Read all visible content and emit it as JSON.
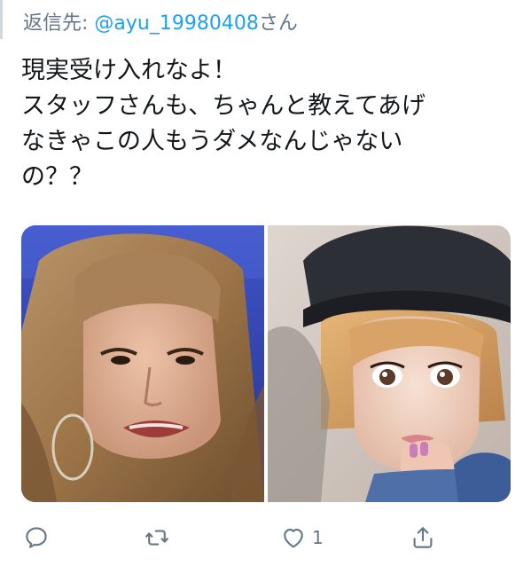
{
  "reply": {
    "prefix": "返信先: ",
    "mention": "@ayu_19980408",
    "suffix": "さん"
  },
  "tweet": {
    "lines": [
      "現実受け入れなよ！",
      "スタッフさんも、ちゃんと教えてあげ",
      "なきゃこの人もうダメなんじゃない",
      "の？？"
    ]
  },
  "media": {
    "photos": [
      {
        "subject": "photo-left"
      },
      {
        "subject": "photo-right"
      }
    ]
  },
  "actions": {
    "reply_count": "",
    "retweet_count": "",
    "like_count": "1",
    "share_count": ""
  },
  "colors": {
    "text": "#14171a",
    "secondary": "#657786",
    "accent": "#1da1f2",
    "thread_line": "#cfd9de"
  },
  "icons": [
    "reply-icon",
    "retweet-icon",
    "heart-icon",
    "share-icon"
  ]
}
